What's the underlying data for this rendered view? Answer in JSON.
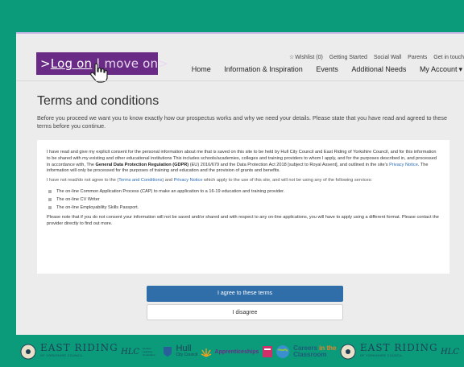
{
  "logo": {
    "log_on": "Log on",
    "divider": "|",
    "move_on": "move on"
  },
  "top_nav": {
    "wishlist": "Wishlist (0)",
    "getting_started": "Getting Started",
    "social_wall": "Social Wall",
    "parents": "Parents",
    "get_in_touch": "Get in touch"
  },
  "main_nav": {
    "home": "Home",
    "information": "Information & Inspiration",
    "events": "Events",
    "additional_needs": "Additional Needs",
    "my_account": "My Account"
  },
  "page": {
    "title": "Terms and conditions",
    "intro": "Before you proceed we want you to know exactly how our prospectus works and why we need your details. Please state that you have read and agreed to these terms before you continue."
  },
  "consent": {
    "p1_a": "I have read and give my explicit consent  for the personal information about me that is saved on this site to be held by Hull City Council and East Riding of Yorkshire Council, and for this information to be shared with my existing and other educational institutions This includes schools/academies, colleges and training providers to whom I apply, and for the purposes described in, and processed in accordance with, The ",
    "gdpr": "General Data Protection Regulation (GDPR)",
    "p1_b": " (EU) 2016/679 and the Data Protection Act 2018 [subject to Royal Assent], and outlined in the site's ",
    "privacy_notice": "Privacy Notice",
    "p1_c": ". The information will only be processed for the purposes of training and education and the provision of grants and benefits.",
    "p2_a": "I have not read/do not agree to the (",
    "terms_link": "Terms and Conditions",
    "p2_b": ") and ",
    "privacy_link": "Privacy Notice",
    "p2_c": " which apply to the use of this site, and will not be using any of the following services:",
    "services": [
      "The on-line Common Application Process (CAP) to make an application to a 16-19 education and training provider.",
      "The on-line CV Writer",
      "The on-line Employability Skills Passport."
    ],
    "p3": "Please note that if you do not consent your information will not be saved and/or shared and with respect to any on-line applications, you will have to apply using a different format. Please contact the provider directly to find out more."
  },
  "buttons": {
    "agree": "I agree to these terms",
    "disagree": "I disagree"
  },
  "footer": {
    "east_riding": "EAST RIDING",
    "east_riding_sub": "OF YORKSHIRE COUNCIL",
    "hlc": "HLC",
    "hlc_sub": "Humber Learning Consortium",
    "hull": "Hull",
    "hull_sub": "City Council",
    "apprenticeships": "Apprenticeships",
    "careers_a": "Careers",
    "careers_in": "in the",
    "careers_b": "Classroom"
  },
  "colors": {
    "brand_purple": "#6a2b86",
    "teal": "#0b9b7b",
    "agree_blue": "#2f6ea9"
  }
}
